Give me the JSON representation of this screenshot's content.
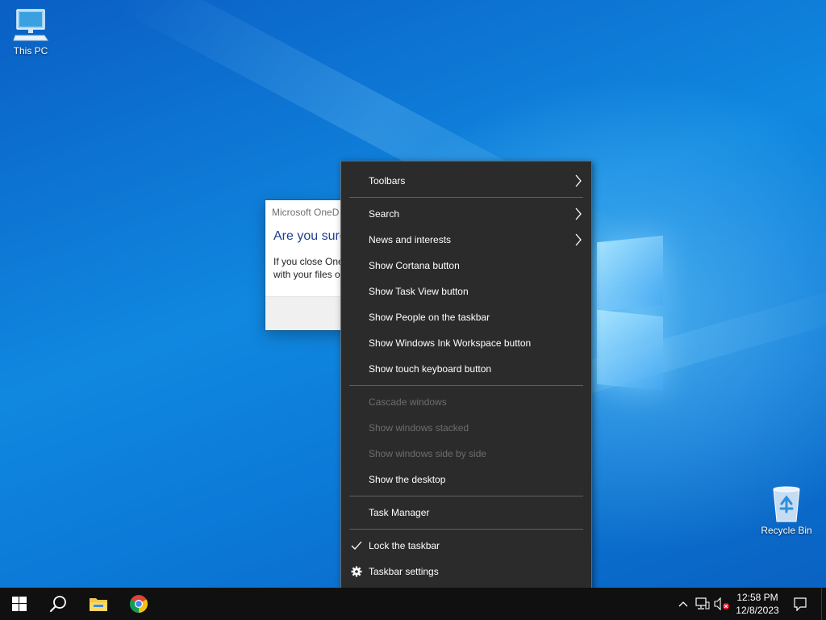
{
  "desktop": {
    "icons": [
      {
        "label": "This PC"
      },
      {
        "label": "Recycle Bin"
      }
    ]
  },
  "onedrive_dialog": {
    "title": "Microsoft OneD",
    "heading": "Are you sure",
    "body_line1": "If you close One",
    "body_line2": "with your files o"
  },
  "context_menu": {
    "items": [
      {
        "label": "Toolbars",
        "submenu": true,
        "enabled": true
      },
      {
        "label": "Search",
        "submenu": true,
        "enabled": true
      },
      {
        "label": "News and interests",
        "submenu": true,
        "enabled": true
      },
      {
        "label": "Show Cortana button",
        "enabled": true
      },
      {
        "label": "Show Task View button",
        "enabled": true
      },
      {
        "label": "Show People on the taskbar",
        "enabled": true
      },
      {
        "label": "Show Windows Ink Workspace button",
        "enabled": true
      },
      {
        "label": "Show touch keyboard button",
        "enabled": true
      },
      {
        "label": "Cascade windows",
        "enabled": false
      },
      {
        "label": "Show windows stacked",
        "enabled": false
      },
      {
        "label": "Show windows side by side",
        "enabled": false
      },
      {
        "label": "Show the desktop",
        "enabled": true
      },
      {
        "label": "Task Manager",
        "enabled": true
      },
      {
        "label": "Lock the taskbar",
        "enabled": true,
        "checked": true,
        "icon": "check-icon"
      },
      {
        "label": "Taskbar settings",
        "enabled": true,
        "icon": "gear-icon"
      }
    ]
  },
  "taskbar": {
    "pinned": [
      {
        "name": "start-icon"
      },
      {
        "name": "search-icon"
      },
      {
        "name": "file-explorer-icon"
      },
      {
        "name": "chrome-icon"
      }
    ],
    "tray": {
      "icons": [
        "chevron-up-icon",
        "network-icon",
        "volume-muted-icon"
      ],
      "time": "12:58 PM",
      "date": "12/8/2023"
    }
  },
  "colors": {
    "menu_bg": "#2b2b2b",
    "menu_text": "#ffffff",
    "menu_disabled": "#6d6d6d",
    "taskbar_bg": "#101010",
    "desktop_blue": "#0b78d6"
  }
}
